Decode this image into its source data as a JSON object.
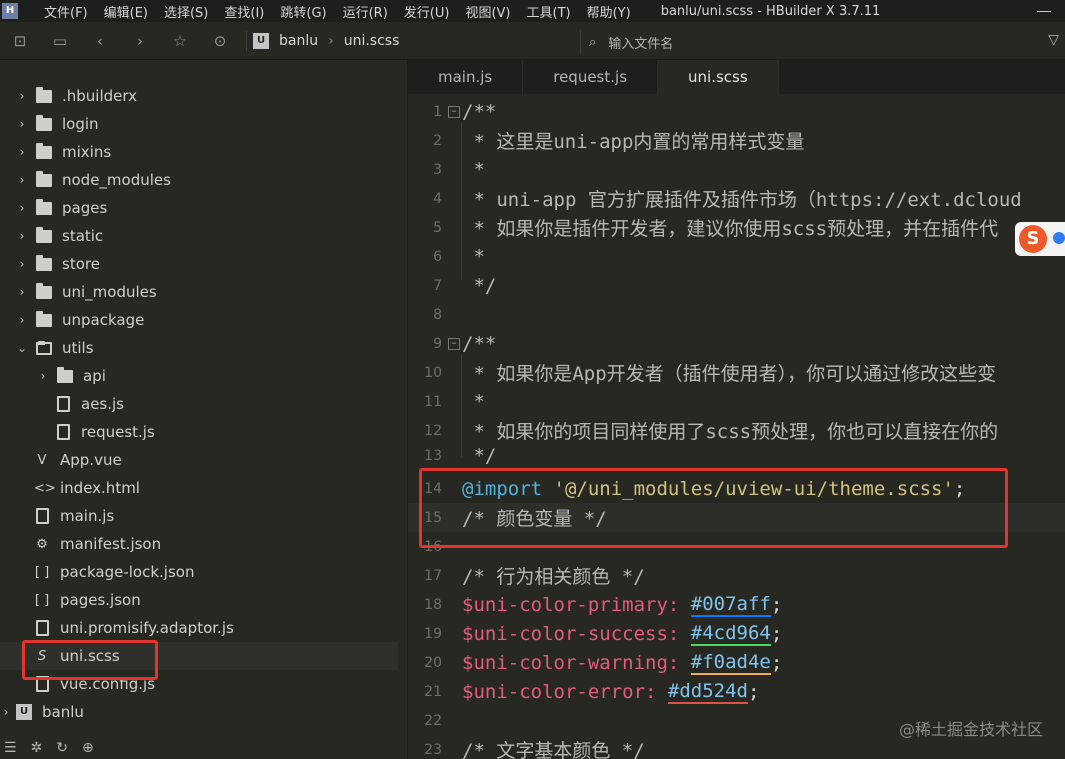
{
  "menubar": {
    "logo": "H",
    "items": [
      "文件(F)",
      "编辑(E)",
      "选择(S)",
      "查找(I)",
      "跳转(G)",
      "运行(R)",
      "发行(U)",
      "视图(V)",
      "工具(T)",
      "帮助(Y)"
    ],
    "window_title": "banlu/uni.scss - HBuilder X 3.7.11"
  },
  "toolbar": {
    "project_icon": "U",
    "project": "banlu",
    "crumb_sep": "›",
    "file": "uni.scss",
    "search_placeholder": "输入文件名",
    "icons": [
      "sidebar-toggle-icon",
      "save-icon",
      "back-icon",
      "forward-icon",
      "star-icon",
      "run-icon",
      "search-icon",
      "filter-icon"
    ]
  },
  "sidebar": {
    "tree": [
      {
        "label": ".hbuilderx",
        "type": "folder"
      },
      {
        "label": "login",
        "type": "folder"
      },
      {
        "label": "mixins",
        "type": "folder"
      },
      {
        "label": "node_modules",
        "type": "folder"
      },
      {
        "label": "pages",
        "type": "folder"
      },
      {
        "label": "static",
        "type": "folder"
      },
      {
        "label": "store",
        "type": "folder"
      },
      {
        "label": "uni_modules",
        "type": "folder"
      },
      {
        "label": "unpackage",
        "type": "folder"
      },
      {
        "label": "utils",
        "type": "folder-open"
      },
      {
        "label": "api",
        "type": "folder"
      },
      {
        "label": "aes.js",
        "type": "file"
      },
      {
        "label": "request.js",
        "type": "file"
      },
      {
        "label": "App.vue",
        "type": "vue"
      },
      {
        "label": "index.html",
        "type": "html"
      },
      {
        "label": "main.js",
        "type": "file"
      },
      {
        "label": "manifest.json",
        "type": "manifest"
      },
      {
        "label": "package-lock.json",
        "type": "json"
      },
      {
        "label": "pages.json",
        "type": "json"
      },
      {
        "label": "uni.promisify.adaptor.js",
        "type": "file"
      },
      {
        "label": "uni.scss",
        "type": "scss"
      },
      {
        "label": "vue.config.js",
        "type": "file"
      },
      {
        "label": "banlu",
        "type": "project"
      }
    ],
    "glyphs": {
      "caret_right": "›",
      "caret_down": "⌄",
      "vue": "V",
      "html": "<>",
      "manifest": "⚙",
      "json": "[ ]",
      "scss": "S",
      "project": "U"
    },
    "bottom_icons": [
      "list-icon",
      "bug-icon",
      "sync-icon",
      "web-icon"
    ]
  },
  "editor": {
    "tabs": [
      "main.js",
      "request.js",
      "uni.scss"
    ],
    "active_tab": "uni.scss",
    "lines": {
      "l1": "/**",
      "l2": " * 这里是uni-app内置的常用样式变量",
      "l3": " *",
      "l4": " * uni-app 官方扩展插件及插件市场（https://ext.dcloud",
      "l5": " * 如果你是插件开发者，建议你使用scss预处理，并在插件代",
      "l6": " *",
      "l7": " */",
      "l8": "",
      "l9": "/**",
      "l10": " * 如果你是App开发者（插件使用者），你可以通过修改这些变",
      "l11": " *",
      "l12": " * 如果你的项目同样使用了scss预处理，你也可以直接在你的",
      "l13": " */",
      "l14_kw": "@import",
      "l14_str": "'@/uni_modules/uview-ui/theme.scss'",
      "l14_end": ";",
      "l15": "/* 颜色变量 */",
      "l16": "",
      "l17": "/* 行为相关颜色 */",
      "l18_var": "$uni-color-primary:",
      "l18_val": "#007aff",
      "l19_var": "$uni-color-success:",
      "l19_val": "#4cd964",
      "l20_var": "$uni-color-warning:",
      "l20_val": "#f0ad4e",
      "l21_var": "$uni-color-error:",
      "l21_val": "#dd524d",
      "l22": "",
      "l23": "/* 文字基本颜色 */",
      "semi": ";"
    },
    "line_numbers": [
      "1",
      "2",
      "3",
      "4",
      "5",
      "6",
      "7",
      "8",
      "9",
      "10",
      "11",
      "12",
      "13",
      "14",
      "15",
      "16",
      "17",
      "18",
      "19",
      "20",
      "21",
      "22",
      "23"
    ],
    "fold_glyph": "−"
  },
  "ime": {
    "label": "S"
  },
  "watermark": "@稀土掘金技术社区",
  "colors": {
    "primary": "#007aff",
    "success": "#4cd964",
    "warning": "#f0ad4e",
    "error": "#dd524d",
    "highlight_box": "#e3342f"
  }
}
